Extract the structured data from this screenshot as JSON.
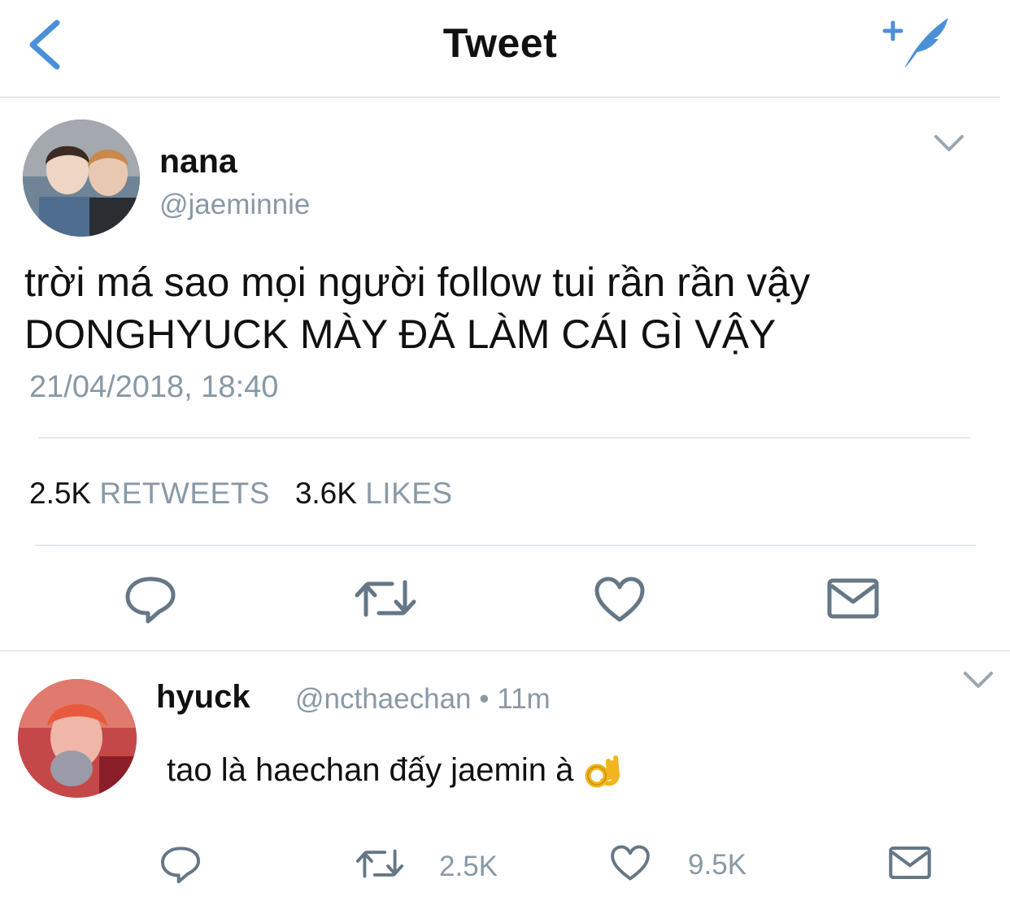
{
  "header": {
    "title": "Tweet",
    "back_icon": "chevron-left-icon",
    "compose_icon": "compose-tweet-icon",
    "accent_color": "#1da1f2"
  },
  "tweet": {
    "display_name": "nana",
    "handle": "@jaeminnie",
    "text_line1": "trời má sao mọi người follow tui rần rần vậy",
    "text_line2": "DONGHYUCK MÀY ĐÃ LÀM CÁI GÌ VẬY",
    "timestamp": "21/04/2018, 18:40",
    "retweets_count": "2.5K",
    "retweets_label": "RETWEETS",
    "likes_count": "3.6K",
    "likes_label": "LIKES",
    "actions": [
      "reply-icon",
      "retweet-icon",
      "like-icon",
      "message-icon"
    ]
  },
  "reply": {
    "display_name": "hyuck",
    "meta": "@ncthaechan • 11m",
    "text": "tao là haechan đấy jaemin à",
    "emoji": "ok-hand-emoji",
    "retweets_count": "2.5K",
    "likes_count": "9.5K"
  }
}
